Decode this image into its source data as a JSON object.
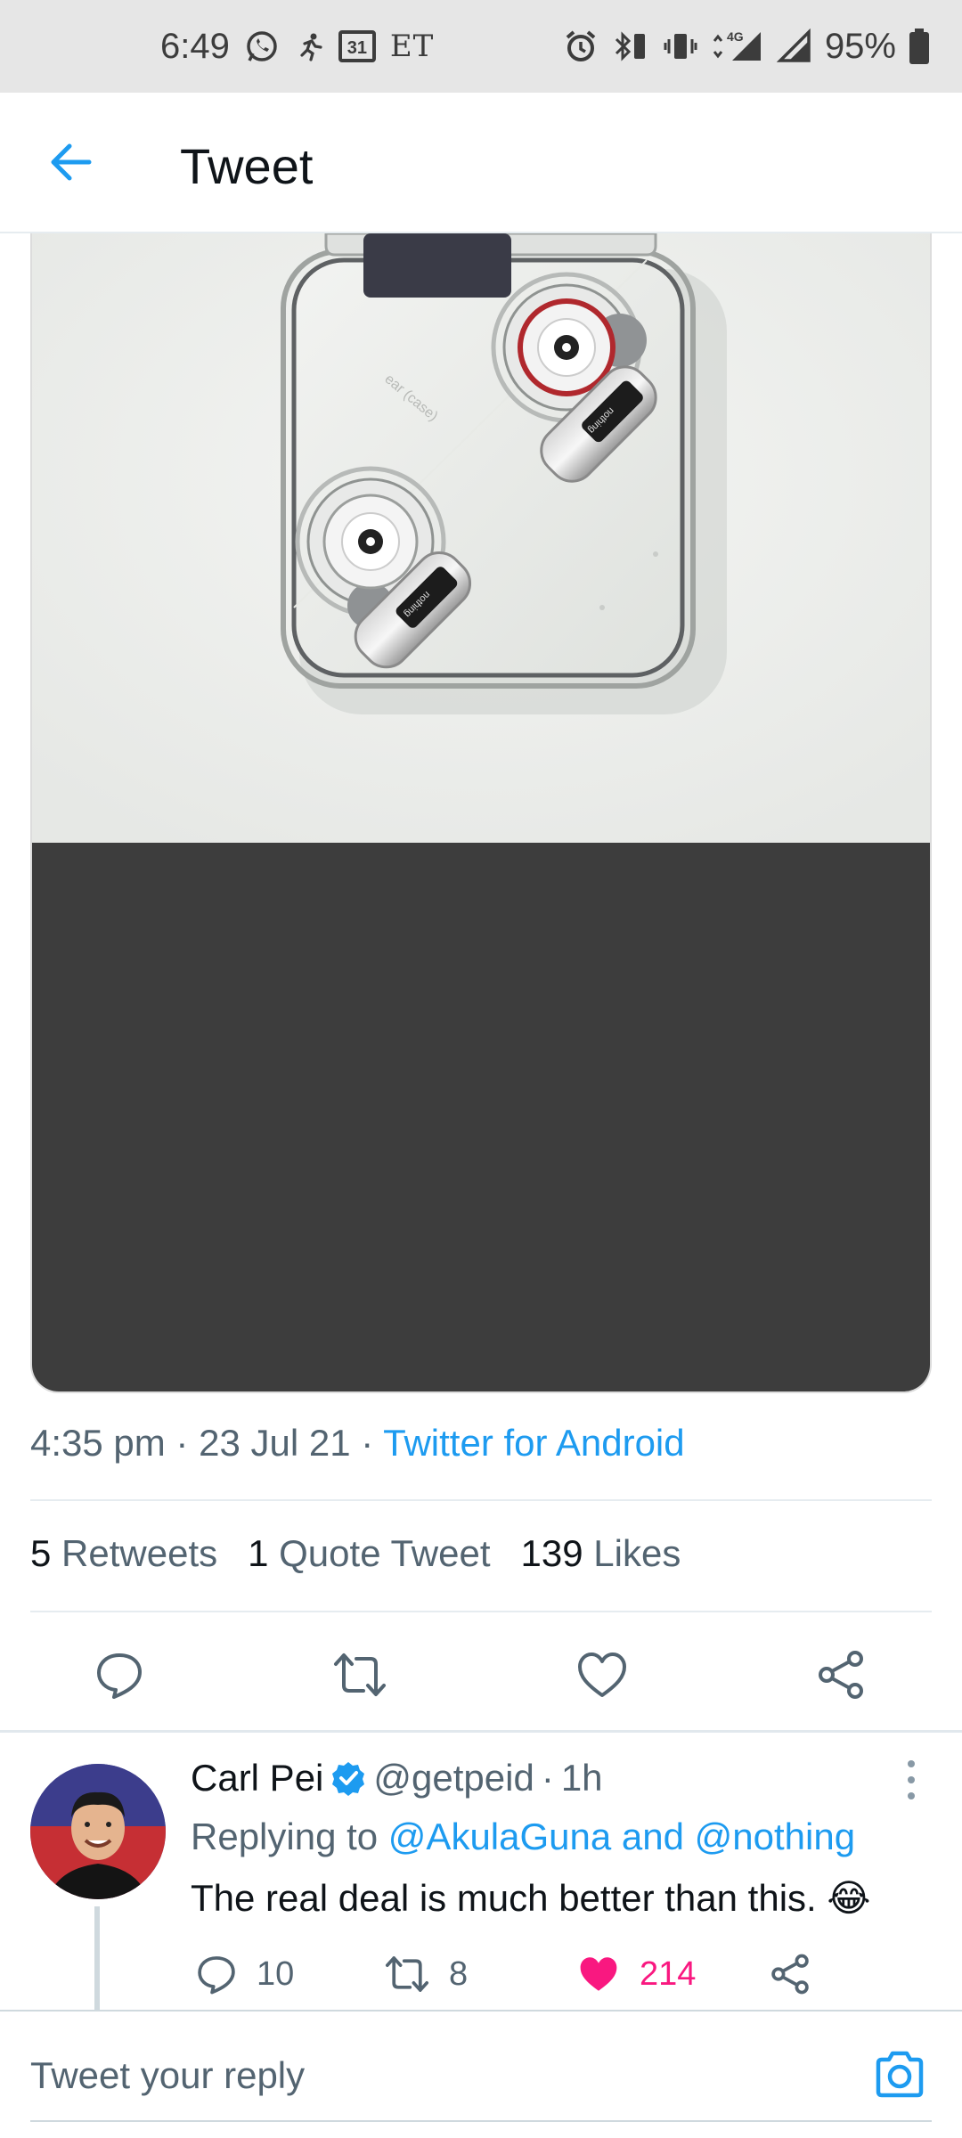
{
  "status_bar": {
    "time": "6:49",
    "calendar_day": "31",
    "et_label": "ET",
    "network": "4G",
    "battery": "95%"
  },
  "header": {
    "title": "Tweet"
  },
  "tweet": {
    "time": "4:35 pm",
    "date": "23 Jul 21",
    "source": "Twitter for Android",
    "stats": {
      "retweets_count": "5",
      "retweets_label": "Retweets",
      "quotes_count": "1",
      "quotes_label": "Quote Tweet",
      "likes_count": "139",
      "likes_label": "Likes"
    },
    "photo_case_text": "ear (case)",
    "photo_bud_text": "nothing"
  },
  "reply": {
    "name": "Carl Pei",
    "handle": "@getpeid",
    "age": "1h",
    "replying_prefix": "Replying to",
    "replying_to": "@AkulaGuna and @nothing",
    "text": "The real deal is much better than this. 😂",
    "reply_count": "10",
    "retweet_count": "8",
    "like_count": "214"
  },
  "compose": {
    "placeholder": "Tweet your reply"
  },
  "colors": {
    "accent": "#1d9bf0",
    "like": "#f91880",
    "muted": "#536471"
  }
}
